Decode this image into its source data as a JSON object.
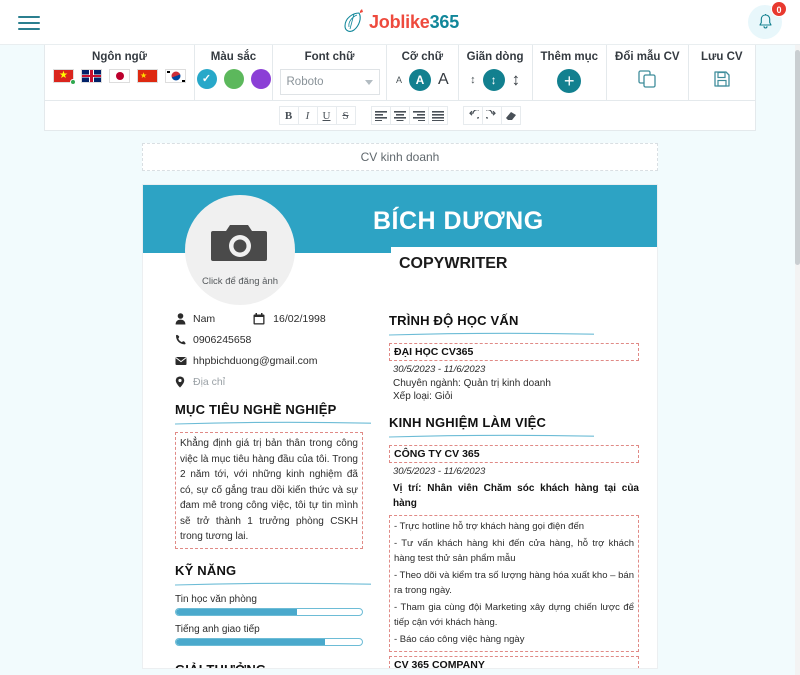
{
  "header": {
    "menu_icon": "hamburger-menu-icon",
    "logo_primary": "Joblike",
    "logo_secondary": "365",
    "notification_icon": "bell-icon",
    "notification_count": "0"
  },
  "toolbar": {
    "groups": [
      {
        "label": "Ngôn ngữ",
        "name": "language-group",
        "flags": [
          {
            "name": "flag-vietnam",
            "selected": true
          },
          {
            "name": "flag-uk",
            "selected": false
          },
          {
            "name": "flag-japan",
            "selected": false
          },
          {
            "name": "flag-china",
            "selected": false
          },
          {
            "name": "flag-korea",
            "selected": false
          }
        ]
      },
      {
        "label": "Màu sắc",
        "name": "color-group",
        "swatches": [
          {
            "name": "color-swatch-cyan",
            "hex": "#27a8c9",
            "selected": true
          },
          {
            "name": "color-swatch-green",
            "hex": "#5cb85c",
            "selected": false
          },
          {
            "name": "color-swatch-purple",
            "hex": "#8b3fd6",
            "selected": false
          }
        ]
      },
      {
        "label": "Font chữ",
        "name": "font-group",
        "font_value": "Roboto"
      },
      {
        "label": "Cỡ chữ",
        "name": "font-size-group",
        "small": "A",
        "medium": "A",
        "large": "A"
      },
      {
        "label": "Giãn dòng",
        "name": "line-spacing-group"
      },
      {
        "label": "Thêm mục",
        "name": "add-section-group"
      },
      {
        "label": "Đổi mẫu CV",
        "name": "change-template-group"
      },
      {
        "label": "Lưu CV",
        "name": "save-cv-group"
      }
    ]
  },
  "formatbar": {
    "bold": "B",
    "italic": "I",
    "underline": "U",
    "strike": "S"
  },
  "cv_title": "CV kinh doanh",
  "cv": {
    "avatar_caption": "Click để đăng ảnh",
    "name": "BÍCH DƯƠNG",
    "role": "COPYWRITER",
    "banner_color": "#2da3c4",
    "contact": {
      "gender": "Nam",
      "birthday": "16/02/1998",
      "phone": "0906245658",
      "email": "hhpbichduong@gmail.com",
      "address_placeholder": "Địa chỉ"
    },
    "objective": {
      "heading": "MỤC TIÊU NGHỀ NGHIỆP",
      "text": "Khẳng định giá trị bản thân trong công việc là mục tiêu hàng đầu của tôi. Trong 2 năm tới, với những kinh nghiệm đã có, sự cố gắng trau dồi kiến thức và sự đam mê trong công việc, tôi tự tin mình sẽ trở thành 1 trưởng phòng CSKH trong tương lai."
    },
    "skills": {
      "heading": "KỸ NĂNG",
      "items": [
        {
          "name": "Tin học văn phòng",
          "percent": 65
        },
        {
          "name": "Tiếng anh giao tiếp",
          "percent": 80
        }
      ]
    },
    "awards": {
      "heading": "GIẢI THƯỞNG"
    },
    "education": {
      "heading": "TRÌNH ĐỘ HỌC VẤN",
      "school": "ĐẠI HỌC CV365",
      "date": "30/5/2023 - 11/6/2023",
      "major": "Chuyên ngành: Quản trị kinh doanh",
      "grade": "Xếp loại: Giỏi"
    },
    "experience": {
      "heading": "KINH NGHIỆM LÀM VIỆC",
      "company": "CÔNG TY  CV 365",
      "date": "30/5/2023 - 11/6/2023",
      "position": "Vị trí: Nhân viên Chăm sóc khách hàng tại của hàng",
      "duties": [
        "- Trực hotline hỗ trợ khách hàng gọi điện đến",
        "- Tư vấn khách hàng khi đến cửa hàng, hỗ trợ khách hàng test thử sản phẩm mẫu",
        "- Theo dõi và kiểm tra số lượng hàng hóa xuất kho – bán ra trong ngày.",
        "- Tham gia cùng đội Marketing xây dựng chiến lược để tiếp cận với khách hàng.",
        "- Báo cáo công việc hàng ngày"
      ],
      "next_company": "CV 365 COMPANY"
    }
  }
}
